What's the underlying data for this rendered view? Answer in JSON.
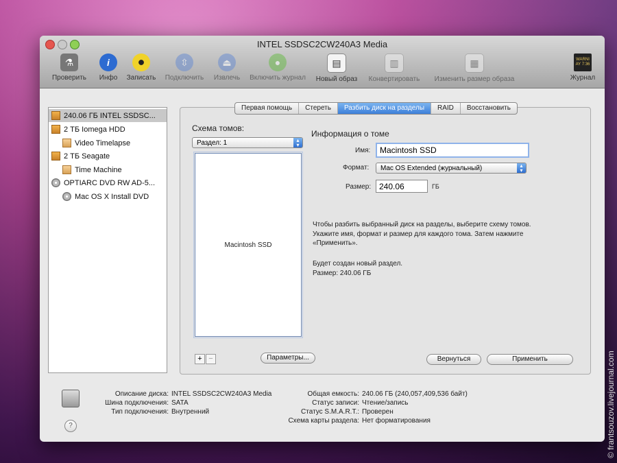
{
  "window": {
    "title": "INTEL SSDSC2CW240A3 Media"
  },
  "toolbar": [
    {
      "label": "Проверить",
      "icon": "microscope-icon"
    },
    {
      "label": "Инфо",
      "icon": "info-icon"
    },
    {
      "label": "Записать",
      "icon": "burn-icon"
    },
    {
      "label": "Подключить",
      "icon": "mount-icon"
    },
    {
      "label": "Извлечь",
      "icon": "eject-icon"
    },
    {
      "label": "Включить журнал",
      "icon": "journal-on-icon"
    },
    {
      "label": "Новый образ",
      "icon": "new-image-icon"
    },
    {
      "label": "Конвертировать",
      "icon": "convert-icon"
    },
    {
      "label": "Изменить размер образа",
      "icon": "resize-image-icon"
    },
    {
      "label": "Журнал",
      "icon": "log-icon"
    }
  ],
  "log_badge": "WARNI\nAY 7:36",
  "sidebar": {
    "items": [
      {
        "label": "240.06 ГБ INTEL SSDSC...",
        "type": "disk"
      },
      {
        "label": "2 ТБ Iomega HDD",
        "type": "disk"
      },
      {
        "label": "Video Timelapse",
        "type": "volume"
      },
      {
        "label": "2 ТБ Seagate",
        "type": "disk"
      },
      {
        "label": "Time Machine",
        "type": "volume"
      },
      {
        "label": "OPTIARC DVD RW AD-5...",
        "type": "dvd"
      },
      {
        "label": "Mac OS X Install DVD",
        "type": "dvd"
      }
    ]
  },
  "tabs": [
    "Первая помощь",
    "Стереть",
    "Разбить диск на разделы",
    "RAID",
    "Восстановить"
  ],
  "partition": {
    "scheme_label": "Схема томов:",
    "scheme_value": "Раздел: 1",
    "volume_name_in_map": "Macintosh SSD",
    "info_title": "Информация о томе",
    "name_label": "Имя:",
    "name_value": "Macintosh SSD",
    "format_label": "Формат:",
    "format_value": "Mac OS Extended (журнальный)",
    "size_label": "Размер:",
    "size_value": "240.06",
    "size_unit": "ГБ",
    "help_line1": "Чтобы разбить выбранный диск на разделы, выберите схему томов.",
    "help_line2": "Укажите имя, формат и размер для каждого тома. Затем нажмите",
    "help_line3": "«Применить».",
    "result_line1": "Будет создан новый раздел.",
    "result_line2": "Размер: 240.06 ГБ",
    "add_label": "+",
    "remove_label": "−",
    "options_button": "Параметры...",
    "revert_button": "Вернуться",
    "apply_button": "Применить"
  },
  "info": {
    "desc_label": "Описание диска:",
    "desc_value": "INTEL SSDSC2CW240A3 Media",
    "bus_label": "Шина подключения:",
    "bus_value": "SATA",
    "type_label": "Тип подключения:",
    "type_value": "Внутренний",
    "capacity_label": "Общая емкость:",
    "capacity_value": "240.06 ГБ (240,057,409,536 байт)",
    "write_label": "Статус записи:",
    "write_value": "Чтение/запись",
    "smart_label": "Статус S.M.A.R.T.:",
    "smart_value": "Проверен",
    "map_label": "Схема карты раздела:",
    "map_value": "Нет форматирования",
    "help_glyph": "?"
  },
  "watermark": "© frantsouzov.livejournal.com",
  "colors": {
    "accent": "#3d7fd9",
    "desktop": "#b0338f"
  }
}
